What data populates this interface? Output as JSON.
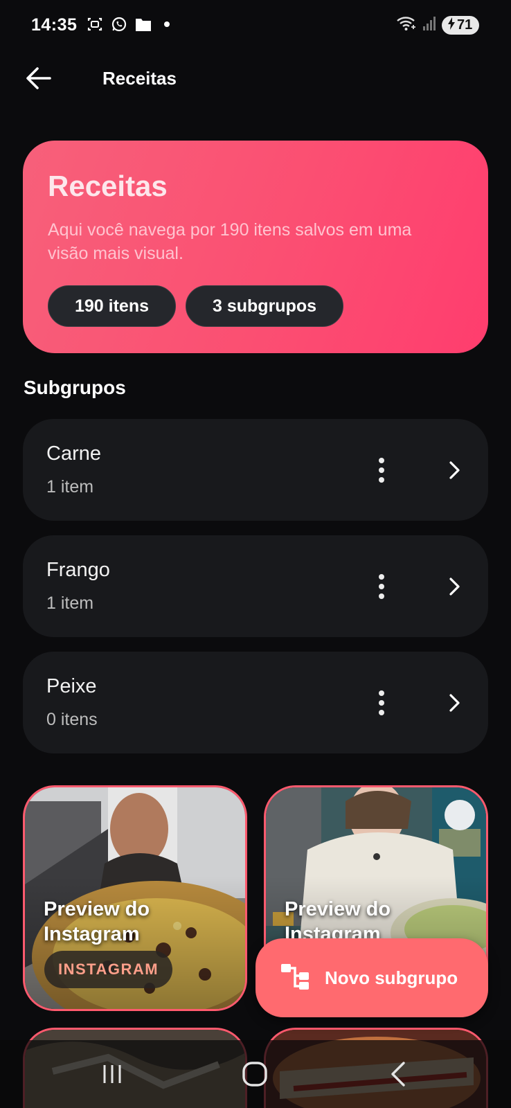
{
  "status_bar": {
    "time": "14:35",
    "battery_level": "71",
    "icons": [
      "screenshot-icon",
      "whatsapp-icon",
      "folder-icon",
      "notification-dot",
      "wifi-icon",
      "signal-icon",
      "battery-charging-icon"
    ]
  },
  "app_bar": {
    "title": "Receitas",
    "back_icon": "arrow-left-icon"
  },
  "hero": {
    "title": "Receitas",
    "description": "Aqui você navega por 190 itens salvos em uma visão mais visual.",
    "chips": [
      "190 itens",
      "3 subgrupos"
    ],
    "gradient_start": "#f7607a",
    "gradient_end": "#ff3d6e"
  },
  "subgroups_section": {
    "title": "Subgrupos",
    "items": [
      {
        "name": "Carne",
        "count": "1 item"
      },
      {
        "name": "Frango",
        "count": "1 item"
      },
      {
        "name": "Peixe",
        "count": "0 itens"
      }
    ]
  },
  "media_cards": [
    {
      "title": "Preview do Instagram",
      "badge": "INSTAGRAM"
    },
    {
      "title": "Preview do Instagram"
    }
  ],
  "fab": {
    "label": "Novo subgrupo",
    "icon": "tree-structure-icon",
    "color": "#ff6a6f"
  },
  "nav_bar": {
    "buttons": [
      "recent-apps-icon",
      "home-icon",
      "back-icon"
    ]
  },
  "colors": {
    "background": "#0b0b0d",
    "card": "#18191c",
    "accent": "#ff5a6e"
  }
}
